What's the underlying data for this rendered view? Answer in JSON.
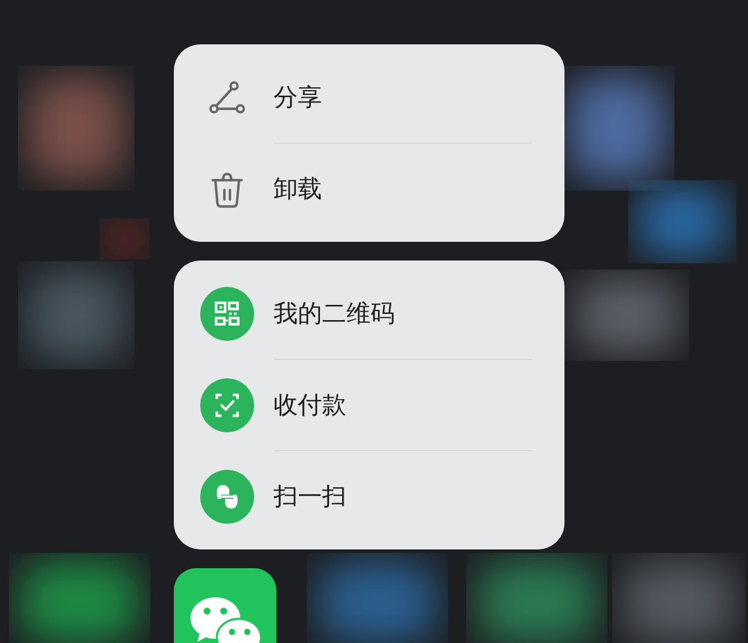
{
  "menus": [
    {
      "items": [
        {
          "kind": "share",
          "label": "分享"
        },
        {
          "kind": "trash",
          "label": "卸载"
        }
      ]
    },
    {
      "items": [
        {
          "kind": "qr",
          "label": "我的二维码"
        },
        {
          "kind": "pay",
          "label": "收付款"
        },
        {
          "kind": "scan",
          "label": "扫一扫"
        }
      ]
    }
  ]
}
